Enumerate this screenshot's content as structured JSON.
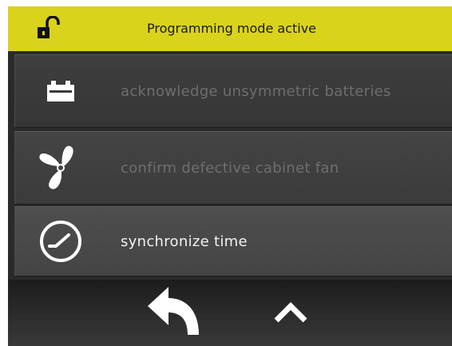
{
  "header": {
    "title": "Programming mode active",
    "icon": "unlocked-padlock-icon",
    "background": "#d9d31c"
  },
  "menu": {
    "items": [
      {
        "label": "acknowledge unsymmetric batteries",
        "icon": "battery-icon",
        "enabled": false
      },
      {
        "label": "confirm defective cabinet fan",
        "icon": "fan-icon",
        "enabled": false
      },
      {
        "label": "synchronize time",
        "icon": "clock-icon",
        "enabled": true
      }
    ]
  },
  "footer": {
    "back_icon": "back-arrow-icon",
    "up_icon": "chevron-up-icon"
  }
}
